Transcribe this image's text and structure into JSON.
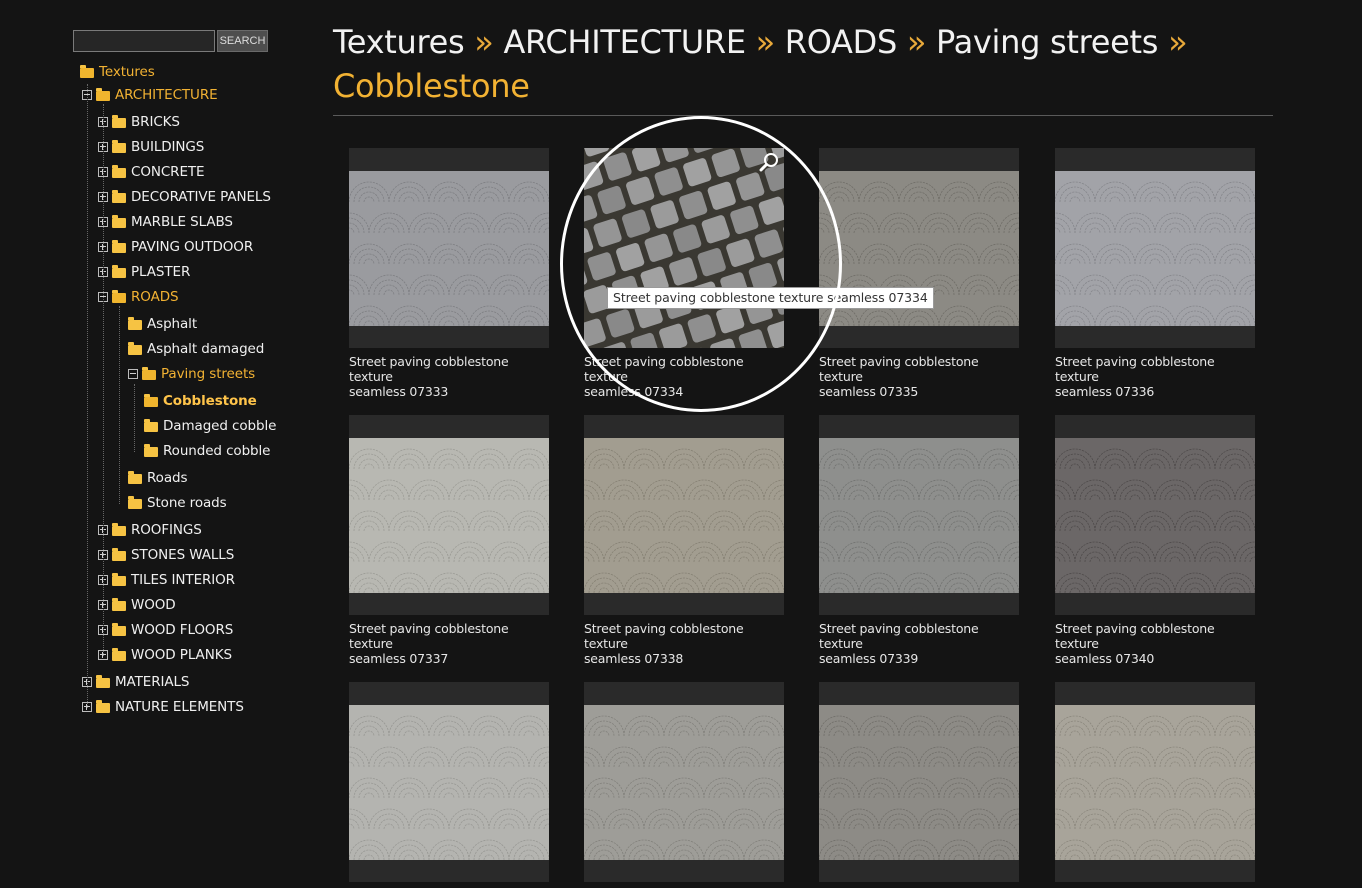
{
  "search": {
    "placeholder": "",
    "button_label": "SEARCH"
  },
  "breadcrumb": {
    "items": [
      "Textures",
      "ARCHITECTURE",
      "ROADS",
      "Paving streets",
      "Cobblestone"
    ],
    "separator": "»"
  },
  "sidebar": {
    "tree": [
      {
        "label": "Textures",
        "level": 0,
        "state": "root-open",
        "style": "active"
      },
      {
        "label": "ARCHITECTURE",
        "level": 1,
        "state": "minus",
        "style": "active"
      },
      {
        "label": "BRICKS",
        "level": 2,
        "state": "plus",
        "style": "normal"
      },
      {
        "label": "BUILDINGS",
        "level": 2,
        "state": "plus",
        "style": "normal"
      },
      {
        "label": "CONCRETE",
        "level": 2,
        "state": "plus",
        "style": "normal"
      },
      {
        "label": "DECORATIVE PANELS",
        "level": 2,
        "state": "plus",
        "style": "normal"
      },
      {
        "label": "MARBLE SLABS",
        "level": 2,
        "state": "plus",
        "style": "normal"
      },
      {
        "label": "PAVING OUTDOOR",
        "level": 2,
        "state": "plus",
        "style": "normal"
      },
      {
        "label": "PLASTER",
        "level": 2,
        "state": "plus",
        "style": "normal"
      },
      {
        "label": "ROADS",
        "level": 2,
        "state": "minus",
        "style": "active"
      },
      {
        "label": "Asphalt",
        "level": 3,
        "state": "leaf",
        "style": "normal"
      },
      {
        "label": "Asphalt damaged",
        "level": 3,
        "state": "leaf",
        "style": "normal"
      },
      {
        "label": "Paving streets",
        "level": 3,
        "state": "minus",
        "style": "active"
      },
      {
        "label": "Cobblestone",
        "level": 4,
        "state": "leaf-open",
        "style": "current"
      },
      {
        "label": "Damaged cobble",
        "level": 4,
        "state": "leaf",
        "style": "normal"
      },
      {
        "label": "Rounded cobble",
        "level": 4,
        "state": "leaf",
        "style": "normal"
      },
      {
        "label": "Roads",
        "level": 3,
        "state": "leaf",
        "style": "normal"
      },
      {
        "label": "Stone roads",
        "level": 3,
        "state": "leaf",
        "style": "normal"
      },
      {
        "label": "ROOFINGS",
        "level": 2,
        "state": "plus",
        "style": "normal"
      },
      {
        "label": "STONES WALLS",
        "level": 2,
        "state": "plus",
        "style": "normal"
      },
      {
        "label": "TILES INTERIOR",
        "level": 2,
        "state": "plus",
        "style": "normal"
      },
      {
        "label": "WOOD",
        "level": 2,
        "state": "plus",
        "style": "normal"
      },
      {
        "label": "WOOD FLOORS",
        "level": 2,
        "state": "plus",
        "style": "normal"
      },
      {
        "label": "WOOD PLANKS",
        "level": 2,
        "state": "plus",
        "style": "normal"
      },
      {
        "label": "MATERIALS",
        "level": 1,
        "state": "plus",
        "style": "normal"
      },
      {
        "label": "NATURE ELEMENTS",
        "level": 1,
        "state": "plus",
        "style": "normal"
      }
    ]
  },
  "grid": {
    "items": [
      {
        "caption_line1": "Street paving cobblestone texture",
        "caption_line2": "seamless 07333",
        "tone": "#9a9b9f",
        "pattern": "fan",
        "icon": "fan-pattern"
      },
      {
        "caption_line1": "Street paving cobblestone texture",
        "caption_line2": "seamless 07334",
        "tone": "#8f8f8f",
        "pattern": "closeup",
        "icon": "zoom-icon"
      },
      {
        "caption_line1": "Street paving cobblestone texture",
        "caption_line2": "seamless 07335",
        "tone": "#8c8a84",
        "pattern": "fan",
        "icon": "fan-pattern"
      },
      {
        "caption_line1": "Street paving cobblestone texture",
        "caption_line2": "seamless 07336",
        "tone": "#a2a3a8",
        "pattern": "fan",
        "icon": "fan-pattern"
      },
      {
        "caption_line1": "Street paving cobblestone texture",
        "caption_line2": "seamless 07337",
        "tone": "#b8b8b2",
        "pattern": "fan",
        "icon": "fan-pattern"
      },
      {
        "caption_line1": "Street paving cobblestone texture",
        "caption_line2": "seamless 07338",
        "tone": "#a29d90",
        "pattern": "fan",
        "icon": "fan-pattern"
      },
      {
        "caption_line1": "Street paving cobblestone texture",
        "caption_line2": "seamless 07339",
        "tone": "#8e8f8d",
        "pattern": "fan",
        "icon": "fan-pattern"
      },
      {
        "caption_line1": "Street paving cobblestone texture",
        "caption_line2": "seamless 07340",
        "tone": "#6b6767",
        "pattern": "fan",
        "icon": "fan-pattern"
      },
      {
        "caption_line1": "",
        "caption_line2": "",
        "tone": "#b4b4b0",
        "pattern": "fan",
        "icon": "fan-pattern"
      },
      {
        "caption_line1": "",
        "caption_line2": "",
        "tone": "#9e9d98",
        "pattern": "fan",
        "icon": "fan-pattern"
      },
      {
        "caption_line1": "",
        "caption_line2": "",
        "tone": "#8d8b86",
        "pattern": "fan",
        "icon": "fan-pattern"
      },
      {
        "caption_line1": "",
        "caption_line2": "",
        "tone": "#a8a49a",
        "pattern": "fan",
        "icon": "fan-pattern"
      }
    ]
  },
  "tooltip": {
    "text": "Street paving cobblestone texture seamless 07334"
  },
  "colors": {
    "background": "#141414",
    "accent": "#f2b233",
    "text": "#e8e8e8"
  }
}
